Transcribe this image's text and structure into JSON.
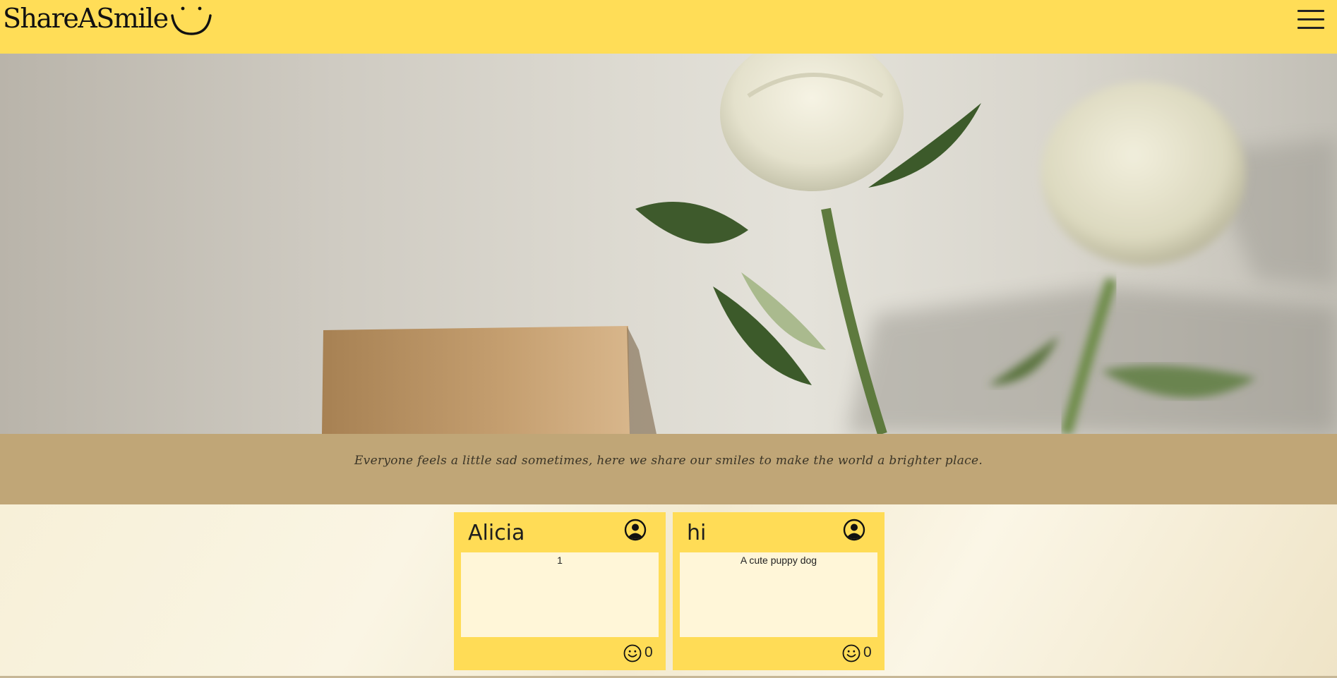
{
  "header": {
    "logo_text": "ShareASmile",
    "logo_icon": "smile-icon",
    "menu_icon": "hamburger-menu-icon",
    "background_color": "#ffdd57"
  },
  "tagline": {
    "text": "Everyone feels a little sad sometimes, here we share our smiles to make the world a brighter place.",
    "background_color": "#c0a677"
  },
  "cards": [
    {
      "name": "Alicia",
      "message": "1",
      "smile_count": "0",
      "avatar_icon": "user-circle-icon",
      "smile_icon": "smile-icon"
    },
    {
      "name": "hi",
      "message": "A cute puppy dog",
      "smile_count": "0",
      "avatar_icon": "user-circle-icon",
      "smile_icon": "smile-icon"
    }
  ],
  "colors": {
    "card": "#ffdc56",
    "card_body": "#fff6d8"
  }
}
